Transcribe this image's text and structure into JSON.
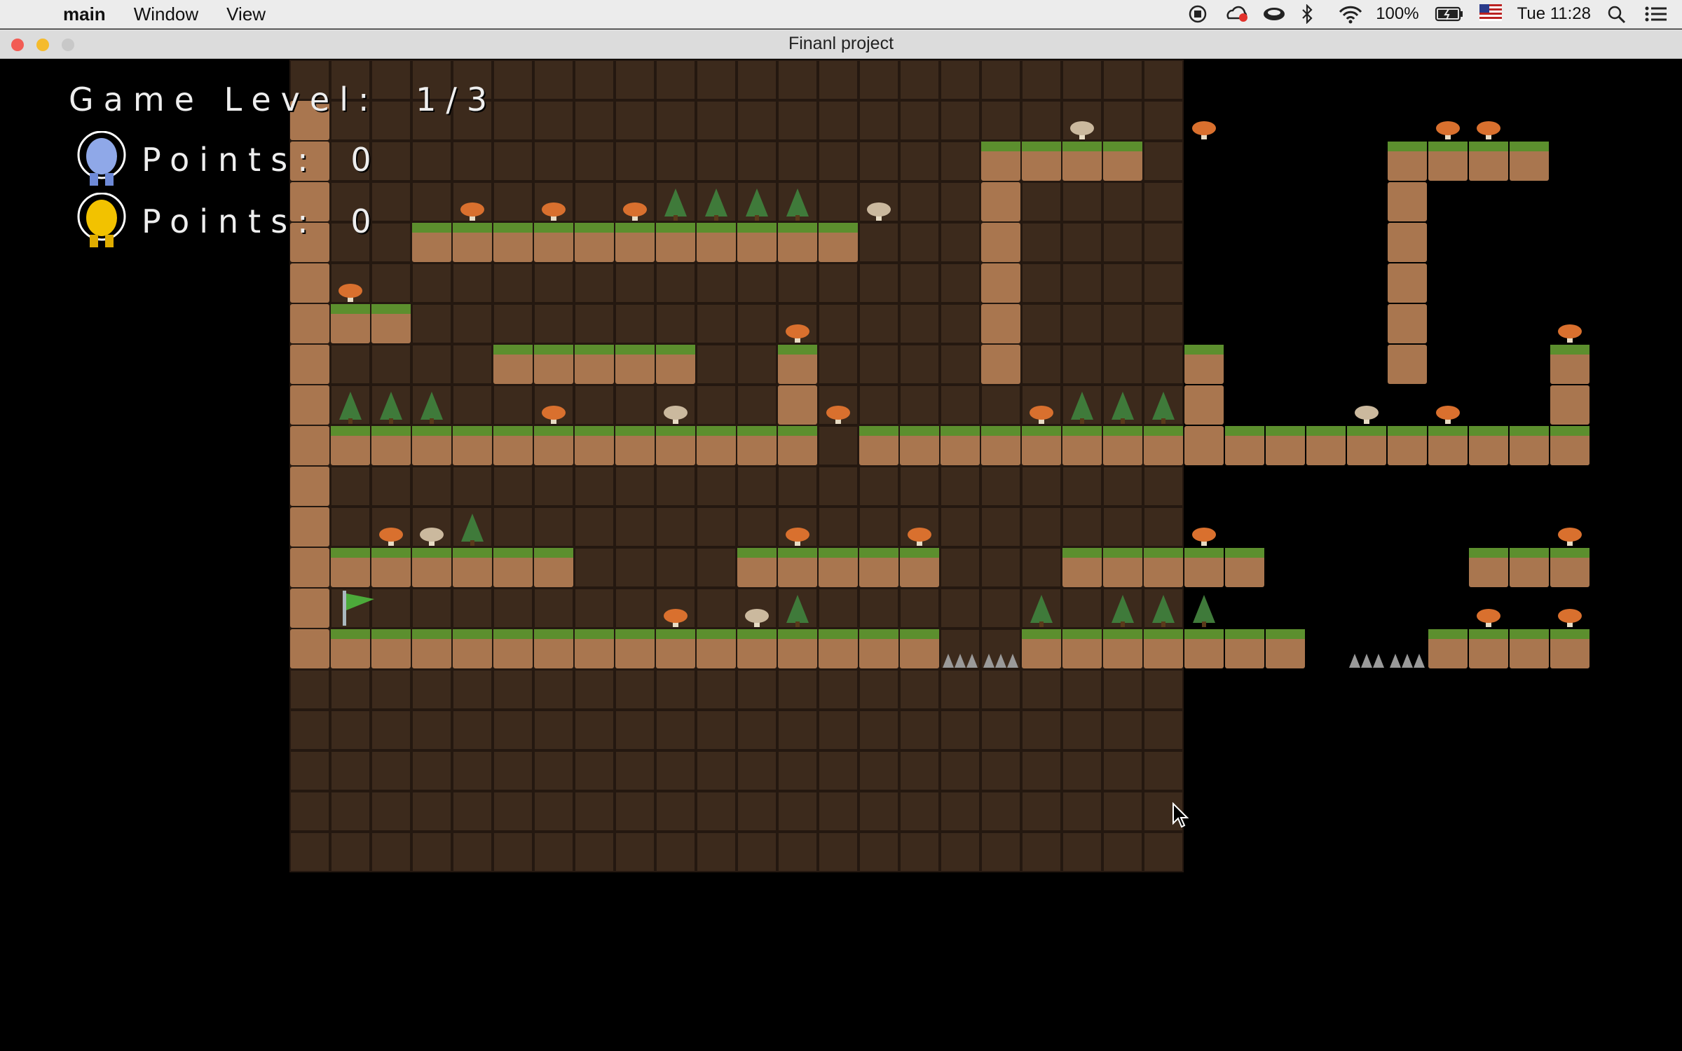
{
  "menubar": {
    "app_name": "main",
    "menus": [
      "Window",
      "View"
    ],
    "battery": "100%",
    "clock": "Tue 11:28"
  },
  "window": {
    "title": "Finanl project"
  },
  "hud": {
    "level_label": "Game Level:",
    "level_value": "1/3",
    "players": [
      {
        "avatar": "blue-alien",
        "color": "#8fa8e8",
        "points_label": "Points:",
        "points": "0"
      },
      {
        "avatar": "yellow-alien",
        "color": "#f2c200",
        "points_label": "Points:",
        "points": "0"
      }
    ]
  },
  "palette": {
    "dirt_dark": "#3c2a1c",
    "dirt_block": "#a9764f",
    "grass": "#5c8f2e",
    "mushroom_orange": "#d9702e",
    "mushroom_beige": "#cbb99e",
    "tree": "#3f7a3a",
    "spike": "#9a9a9a"
  }
}
